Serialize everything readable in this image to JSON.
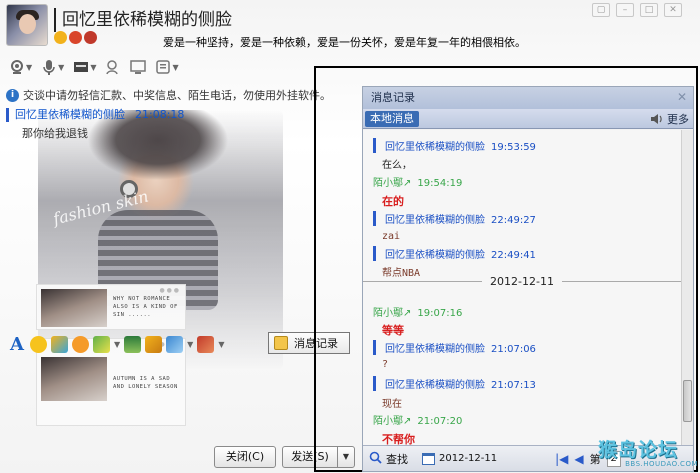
{
  "window": {
    "title": "回忆里依稀模糊的侧脸",
    "signature": "爱是一种坚持，爱是一种依赖，爱是一份关怀，爱是年复一年的相偎相依。"
  },
  "notice": {
    "text": "交谈中请勿轻信汇款、中奖信息、陌生电话，勿使用外挂软件。"
  },
  "history": [
    {
      "sender": "回忆里依稀模糊的侧脸",
      "time": "21:08:18",
      "text": "那你给我退钱"
    }
  ],
  "skin": {
    "logo": "fashion skin",
    "card_1_text": "WHY NOT ROMANCE\nALSO IS A KIND OF\nSIN ......",
    "card_2_text": "AUTUMN IS A SAD\nAND LONELY SEASON"
  },
  "toolbar": {
    "history_button": "消息记录",
    "close_button": "关闭(C)",
    "send_button": "发送(S)"
  },
  "panel": {
    "title": "消息记录",
    "tab_local": "本地消息",
    "more": "更多",
    "find": "查找",
    "date": "2012-12-11",
    "page_label": "第",
    "page_value": "2"
  },
  "log": [
    {
      "kind": "me",
      "sender": "回忆里依稀模糊的侧脸",
      "time": "19:53:59"
    },
    {
      "kind": "text",
      "text": "在么，"
    },
    {
      "kind": "other",
      "sender": "陌小鄢↗",
      "time": "19:54:19"
    },
    {
      "kind": "red",
      "text": "在的"
    },
    {
      "kind": "me",
      "sender": "回忆里依稀模糊的侧脸",
      "time": "22:49:27"
    },
    {
      "kind": "brown",
      "text": "zai"
    },
    {
      "kind": "me",
      "sender": "回忆里依稀模糊的侧脸",
      "time": "22:49:41"
    },
    {
      "kind": "brown",
      "text": "帮点NBA"
    },
    {
      "kind": "date",
      "text": "2012-12-11"
    },
    {
      "kind": "other",
      "sender": "陌小鄢↗",
      "time": "19:07:16"
    },
    {
      "kind": "red",
      "text": "等等"
    },
    {
      "kind": "me",
      "sender": "回忆里依稀模糊的侧脸",
      "time": "21:07:06"
    },
    {
      "kind": "brown",
      "text": "?"
    },
    {
      "kind": "me",
      "sender": "回忆里依稀模糊的侧脸",
      "time": "21:07:13"
    },
    {
      "kind": "brown",
      "text": "现在"
    },
    {
      "kind": "other",
      "sender": "陌小鄢↗",
      "time": "21:07:20"
    },
    {
      "kind": "red",
      "text": "不帮你"
    }
  ],
  "watermark": {
    "main": "猴岛论坛",
    "url": "BBS.HOUDAO.COM"
  },
  "colors": {
    "sender_me": "#1a4fc4",
    "sender_other": "#39a64a",
    "reply_red": "#d81e1e",
    "panel_header": "#b2c0da",
    "tab_active": "#3a6cb4"
  }
}
